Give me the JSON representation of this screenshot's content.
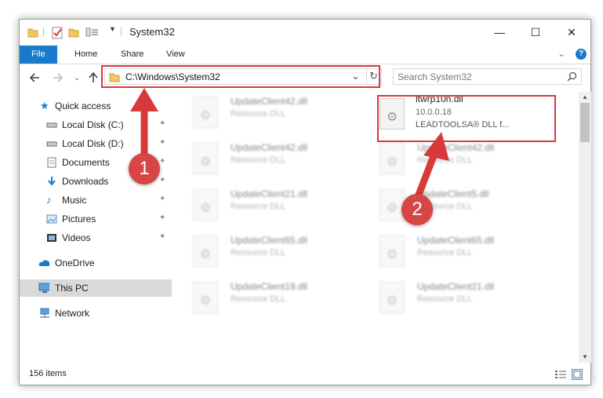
{
  "window": {
    "title": "System32",
    "controls": {
      "minimize": "—",
      "maximize": "☐",
      "close": "✕"
    }
  },
  "ribbon": {
    "tabs": [
      "File",
      "Home",
      "Share",
      "View"
    ],
    "expand_glyph": "⌄",
    "help_glyph": "?"
  },
  "address_bar": {
    "path": "C:\\Windows\\System32",
    "refresh_glyph": "↻",
    "dropdown_glyph": "⌄"
  },
  "search": {
    "placeholder": "Search System32",
    "icon": "search-icon"
  },
  "sidebar": {
    "quick_access": "Quick access",
    "items": [
      {
        "label": "Local Disk (C:)",
        "icon": "drive-icon"
      },
      {
        "label": "Local Disk (D:)",
        "icon": "drive-icon"
      },
      {
        "label": "Documents",
        "icon": "documents-icon"
      },
      {
        "label": "Downloads",
        "icon": "downloads-icon"
      },
      {
        "label": "Music",
        "icon": "music-icon"
      },
      {
        "label": "Pictures",
        "icon": "pictures-icon"
      },
      {
        "label": "Videos",
        "icon": "videos-icon"
      }
    ],
    "onedrive": "OneDrive",
    "this_pc": "This PC",
    "network": "Network",
    "pin_glyph": "📌"
  },
  "files": {
    "highlighted": {
      "name": "ltwrp10n.dll",
      "version": "10.0.0.18",
      "description": "LEADTOOLSA® DLL f..."
    },
    "left_column": [
      {
        "name": "UpdateClient42.dll",
        "type": "Resource DLL"
      },
      {
        "name": "UpdateClient42.dll",
        "type": "Resource DLL"
      },
      {
        "name": "UpdateClient21.dll",
        "type": "Resource DLL"
      },
      {
        "name": "UpdateClient65.dll",
        "type": "Resource DLL"
      },
      {
        "name": "UpdateClient19.dll",
        "type": "Resource DLL"
      }
    ],
    "right_column": [
      {
        "name": "UpdateClient42.dll",
        "type": "Resource DLL"
      },
      {
        "name": "UpdateClient5.dll",
        "type": "Resource DLL"
      },
      {
        "name": "UpdateClient65.dll",
        "type": "Resource DLL"
      },
      {
        "name": "UpdateClient21.dll",
        "type": "Resource DLL"
      }
    ]
  },
  "status_bar": {
    "item_count": "156 items"
  },
  "annotations": {
    "step1": "1",
    "step2": "2",
    "color": "#d83a3a"
  }
}
